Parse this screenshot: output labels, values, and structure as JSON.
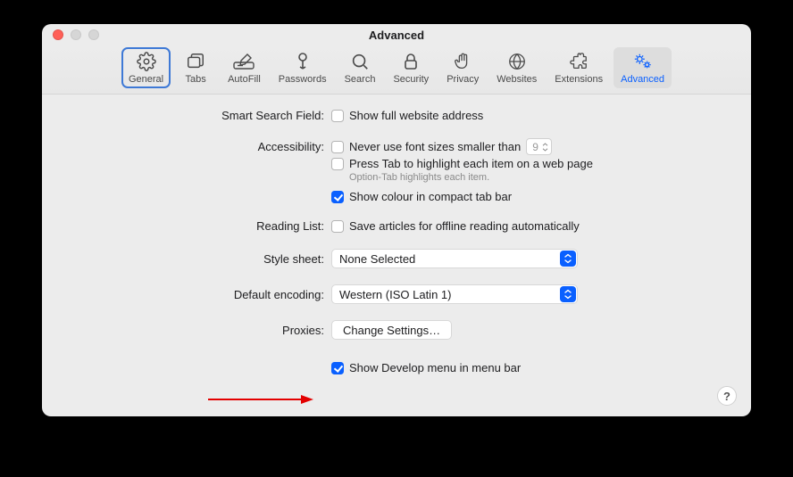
{
  "window": {
    "title": "Advanced"
  },
  "toolbar": {
    "general": "General",
    "tabs": "Tabs",
    "autofill": "AutoFill",
    "passwords": "Passwords",
    "search": "Search",
    "security": "Security",
    "privacy": "Privacy",
    "websites": "Websites",
    "extensions": "Extensions",
    "advanced": "Advanced"
  },
  "labels": {
    "smart_search": "Smart Search Field:",
    "accessibility": "Accessibility:",
    "reading_list": "Reading List:",
    "style_sheet": "Style sheet:",
    "default_encoding": "Default encoding:",
    "proxies": "Proxies:"
  },
  "options": {
    "show_full_url": "Show full website address",
    "never_font_smaller": "Never use font sizes smaller than",
    "min_font_size": "9",
    "press_tab": "Press Tab to highlight each item on a web page",
    "option_tab_hint": "Option-Tab highlights each item.",
    "show_colour_compact": "Show colour in compact tab bar",
    "save_offline": "Save articles for offline reading automatically",
    "style_sheet_value": "None Selected",
    "encoding_value": "Western (ISO Latin 1)",
    "change_settings": "Change Settings…",
    "show_develop": "Show Develop menu in menu bar"
  },
  "checked": {
    "show_full_url": false,
    "never_font_smaller": false,
    "press_tab": false,
    "show_colour_compact": true,
    "save_offline": false,
    "show_develop": true
  },
  "help": "?"
}
